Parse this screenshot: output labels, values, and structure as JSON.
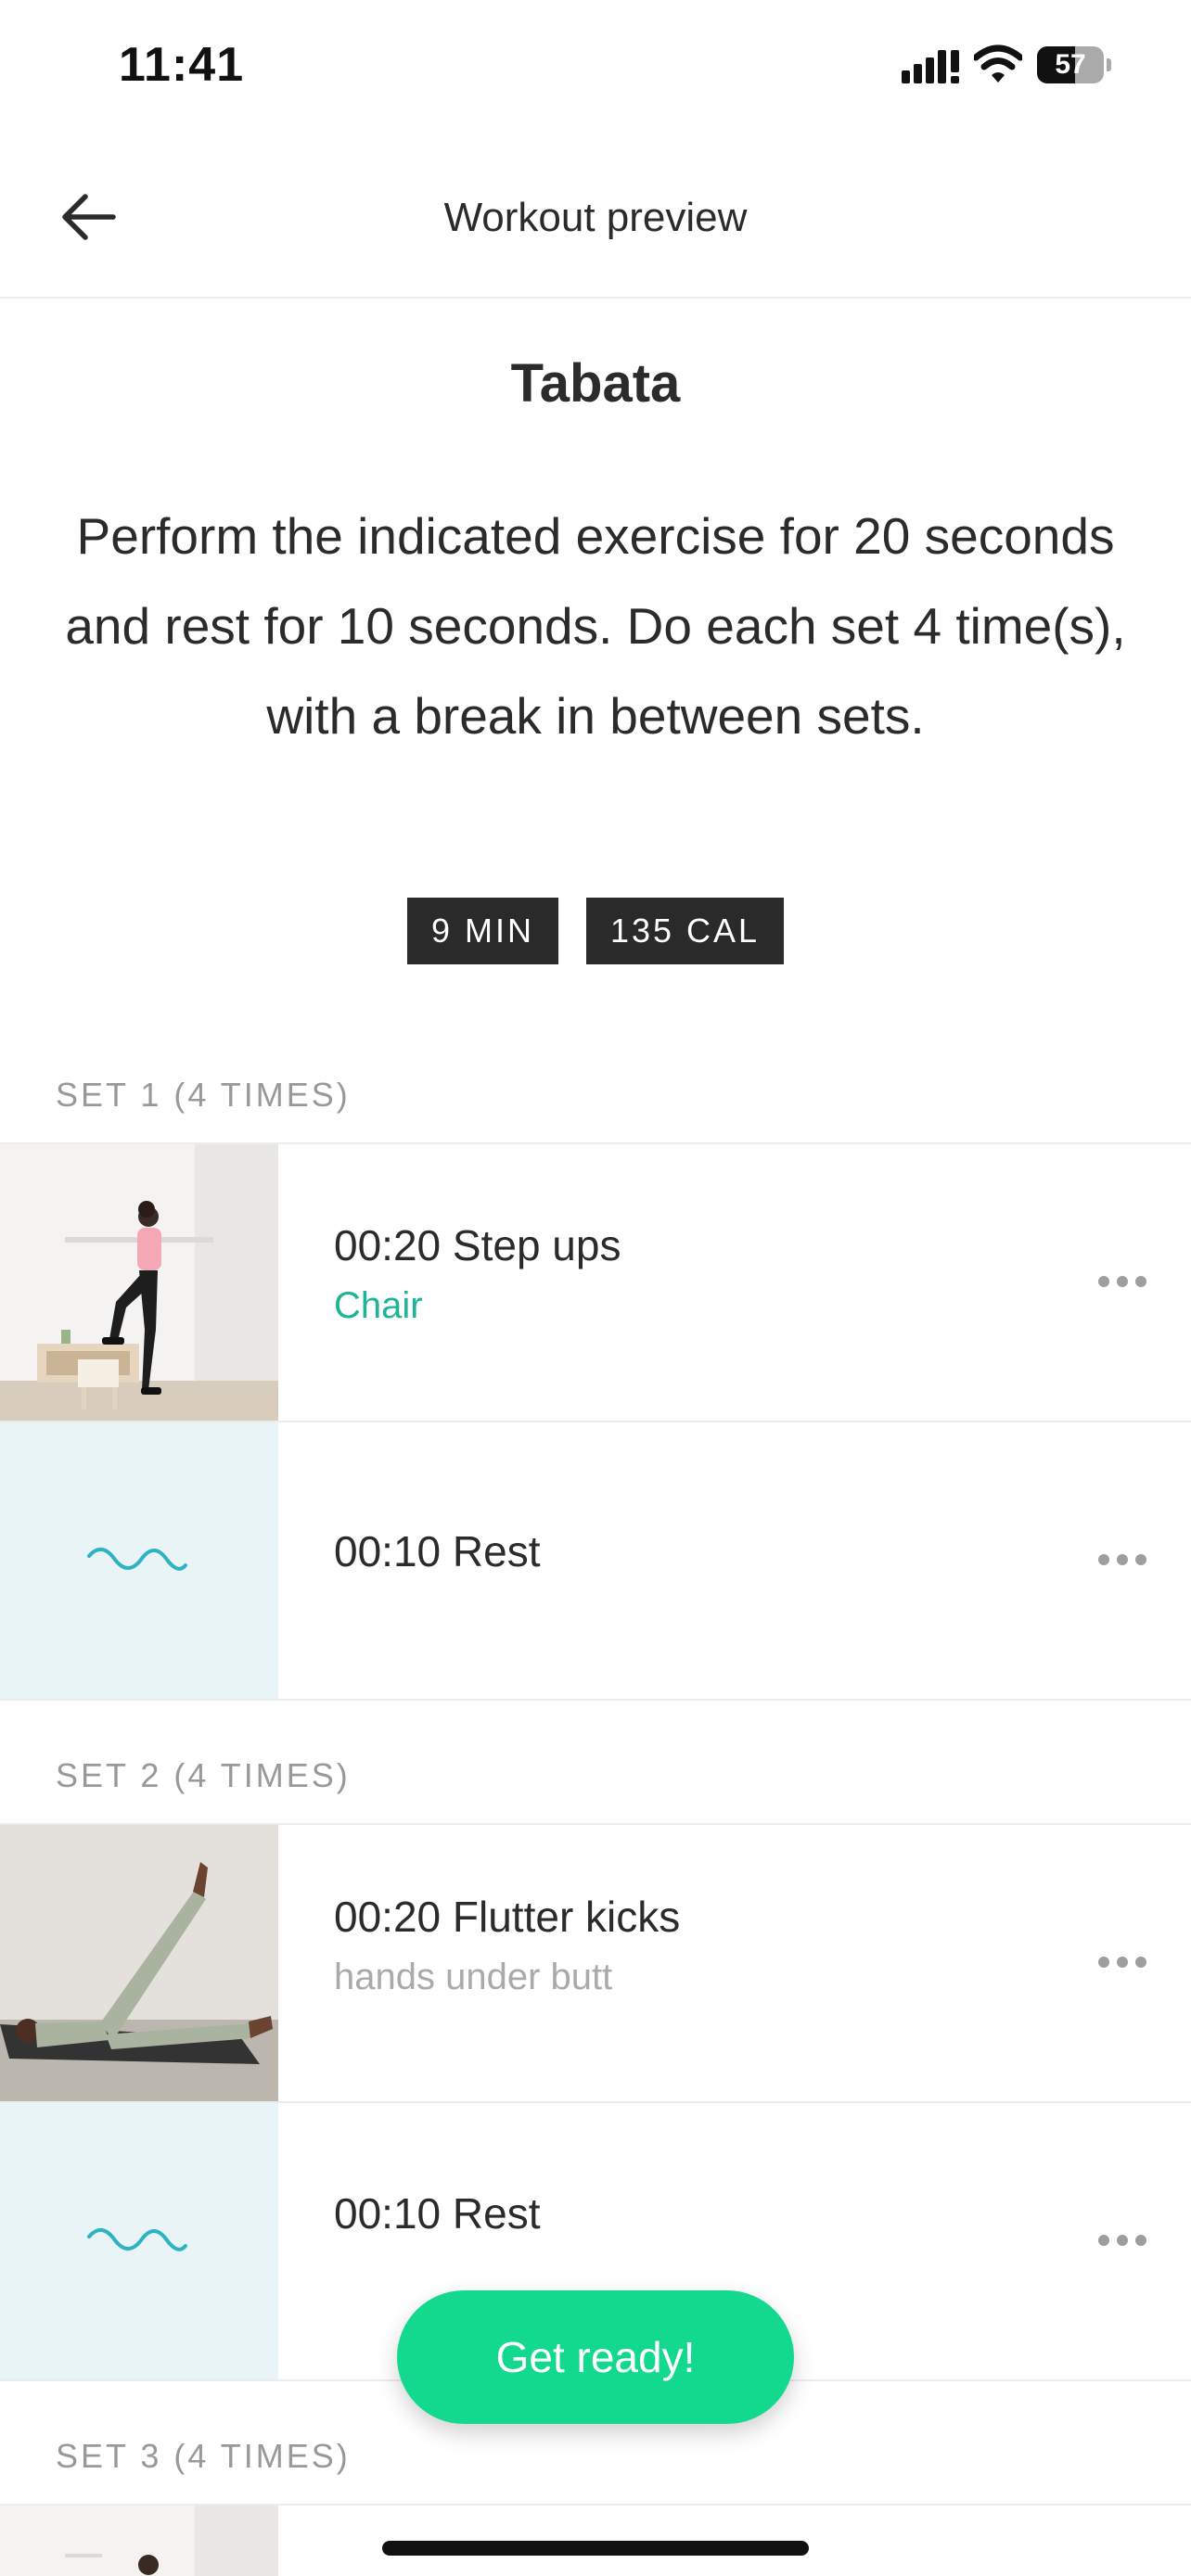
{
  "status": {
    "time": "11:41",
    "battery": "57",
    "battery_level": 0.57
  },
  "header": {
    "title": "Workout preview"
  },
  "workout": {
    "title": "Tabata",
    "description": "Perform the indicated exercise for 20 seconds and rest for 10 seconds. Do each set 4 time(s), with a break in between sets.",
    "badges": [
      "9 MIN",
      "135 CAL"
    ]
  },
  "sets": [
    {
      "label": "SET 1 (4 TIMES)",
      "items": [
        {
          "title": "00:20 Step ups",
          "subtitle": "Chair"
        },
        {
          "title": "00:10 Rest"
        }
      ]
    },
    {
      "label": "SET 2 (4 TIMES)",
      "items": [
        {
          "title": "00:20 Flutter kicks",
          "subtitle": "hands under butt"
        },
        {
          "title": "00:10 Rest"
        }
      ]
    },
    {
      "label": "SET 3 (4 TIMES)"
    }
  ],
  "cta": {
    "label": "Get ready!"
  },
  "colors": {
    "accent": "#13d98e",
    "equipment": "#1fb496",
    "rest_wave": "#2fb3c4"
  },
  "icons": [
    "back-arrow-icon",
    "signal-icon",
    "wifi-icon",
    "battery-icon",
    "more-icon",
    "rest-wave-icon"
  ]
}
